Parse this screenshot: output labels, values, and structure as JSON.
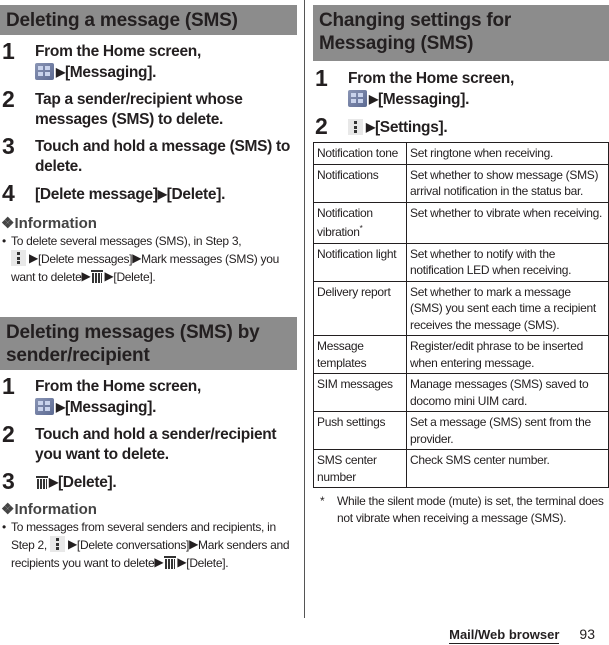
{
  "left": {
    "section1": {
      "title": "Deleting a message (SMS)",
      "steps": [
        {
          "num": "1",
          "line1": "From the Home screen,",
          "line2": "[Messaging]."
        },
        {
          "num": "2",
          "text": "Tap a sender/recipient whose messages (SMS) to delete."
        },
        {
          "num": "3",
          "text": "Touch and hold a message (SMS) to delete."
        },
        {
          "num": "4",
          "a": "[Delete message]",
          "b": "[Delete]."
        }
      ],
      "info": {
        "heading": "Information",
        "symbol": "❖",
        "bullet": "•",
        "t1": "To delete several messages (SMS), in Step 3,",
        "t2": "[Delete messages]",
        "t3": "Mark messages (SMS) you want to delete",
        "t4": "[Delete]."
      }
    },
    "section2": {
      "title": "Deleting messages (SMS) by sender/recipient",
      "steps": [
        {
          "num": "1",
          "line1": "From the Home screen,",
          "line2": "[Messaging]."
        },
        {
          "num": "2",
          "text": "Touch and hold a sender/recipient you want to delete."
        },
        {
          "num": "3",
          "b": "[Delete]."
        }
      ],
      "info": {
        "heading": "Information",
        "symbol": "❖",
        "bullet": "•",
        "t1": "To messages from several senders and recipients, in Step 2,",
        "t2": "[Delete conversations]",
        "t3": "Mark senders and recipients you want to delete",
        "t4": "[Delete]."
      }
    }
  },
  "right": {
    "section3": {
      "title": "Changing settings for Messaging (SMS)",
      "steps": [
        {
          "num": "1",
          "line1": "From the Home screen,",
          "line2": "[Messaging]."
        },
        {
          "num": "2",
          "b": "[Settings]."
        }
      ],
      "table": [
        {
          "key": "Notification tone",
          "value": "Set ringtone when receiving."
        },
        {
          "key": "Notifications",
          "value": "Set whether to show message (SMS) arrival notification in the status bar."
        },
        {
          "key": "Notification vibration",
          "key_sup": "*",
          "value": "Set whether to vibrate when receiving."
        },
        {
          "key": "Notification light",
          "value": "Set whether to notify with the notification LED when receiving."
        },
        {
          "key": "Delivery report",
          "value": "Set whether to mark a message (SMS) you sent each time a recipient receives the message (SMS)."
        },
        {
          "key": "Message templates",
          "value": "Register/edit phrase to be inserted when entering message."
        },
        {
          "key": "SIM messages",
          "value": "Manage messages (SMS) saved to docomo mini UIM card."
        },
        {
          "key": "Push settings",
          "value": "Set a message (SMS) sent from the provider."
        },
        {
          "key": "SMS center number",
          "value": "Check SMS center number."
        }
      ],
      "footnote": {
        "mark": "*",
        "text": "While the silent mode (mute) is set, the terminal does not vibrate when receiving a message (SMS)."
      }
    }
  },
  "arrow": "▶",
  "footer": {
    "label": "Mail/Web browser",
    "page": "93"
  }
}
